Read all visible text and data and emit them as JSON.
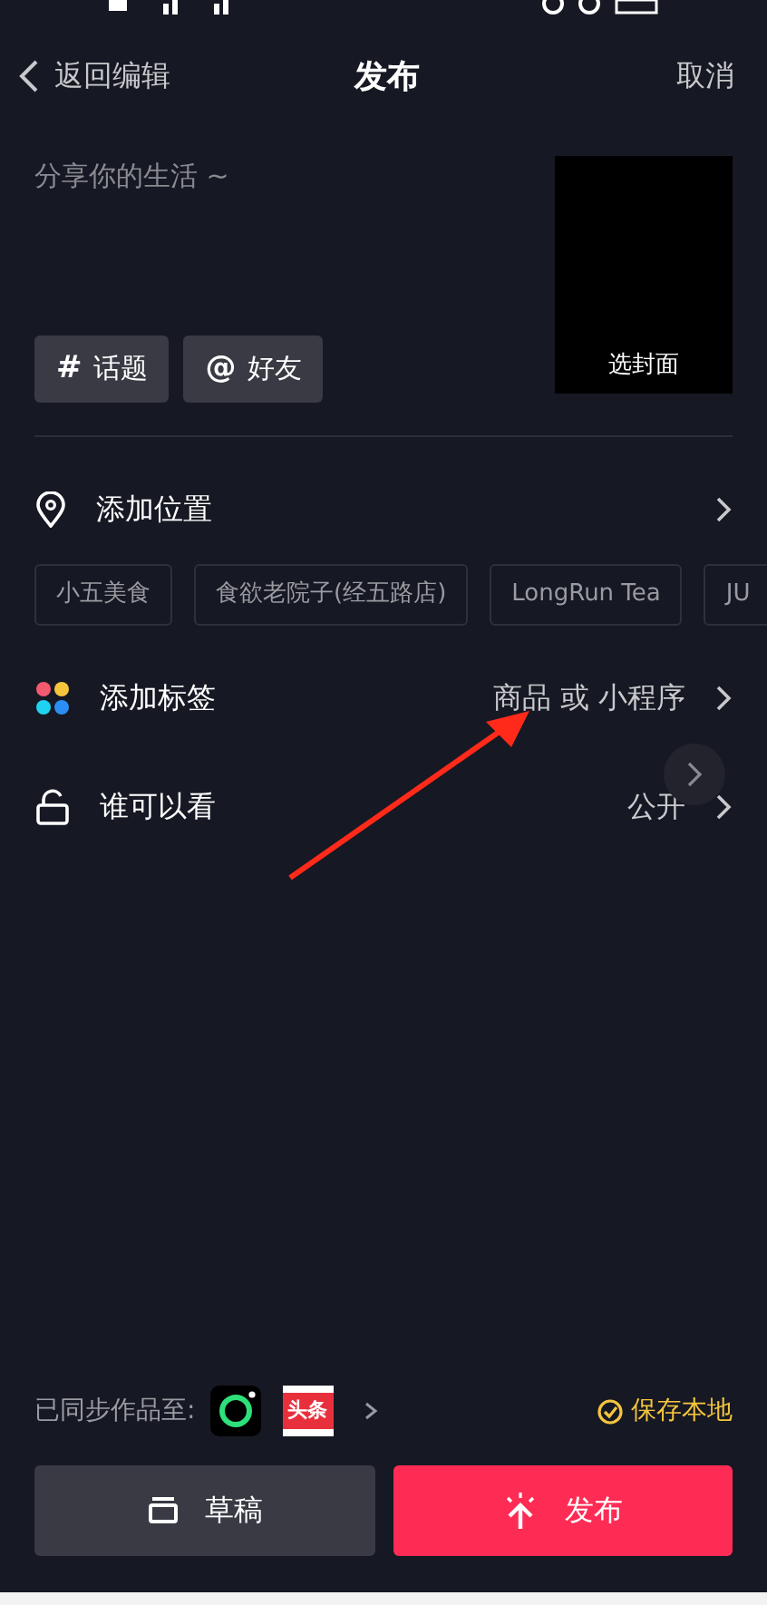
{
  "nav": {
    "back": "返回编辑",
    "title": "发布",
    "cancel": "取消"
  },
  "caption": {
    "placeholder": "分享你的生活 ~"
  },
  "cover": {
    "label": "选封面"
  },
  "quick_buttons": [
    {
      "symbol": "#",
      "label": "话题"
    },
    {
      "symbol": "@",
      "label": "好友"
    }
  ],
  "location": {
    "label": "添加位置",
    "suggestions": [
      "小五美食",
      "食欲老院子(经五路店)",
      "LongRun Tea",
      "JU"
    ]
  },
  "settings": [
    {
      "kind": "tags",
      "label": "添加标签",
      "value": "商品 或 小程序"
    },
    {
      "kind": "visibility",
      "label": "谁可以看",
      "value": "公开"
    }
  ],
  "sync": {
    "label": "已同步作品至:",
    "targets": [
      {
        "kind": "ring"
      },
      {
        "kind": "news",
        "label": "头条"
      }
    ],
    "save_local": {
      "label": "保存本地",
      "checked": true
    }
  },
  "actions": [
    {
      "kind": "draft",
      "label": "草稿"
    },
    {
      "kind": "publish",
      "label": "发布"
    }
  ]
}
